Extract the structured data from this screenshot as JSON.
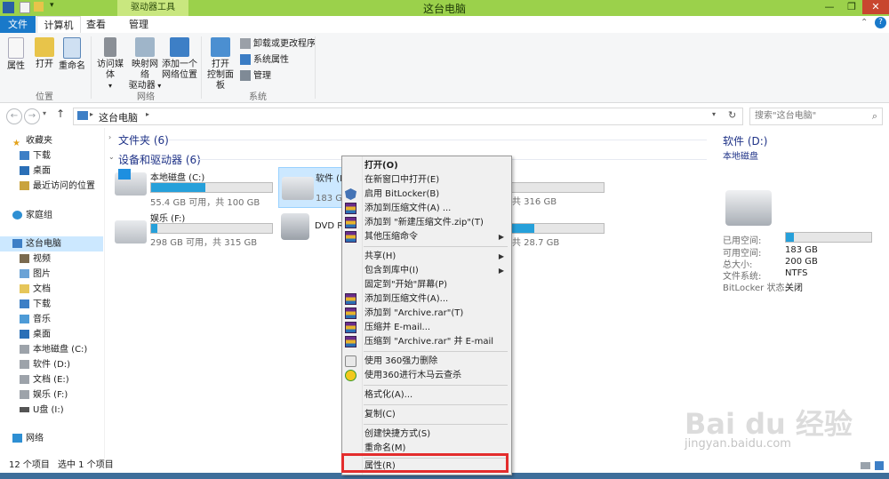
{
  "window": {
    "title": "这台电脑",
    "context_tab_header": "驱动器工具",
    "controls": [
      "—",
      "❐",
      "✕"
    ]
  },
  "tabs": {
    "file": "文件",
    "computer": "计算机",
    "view": "查看",
    "manage": "管理"
  },
  "ribbon": {
    "location": {
      "label": "位置",
      "properties": "属性",
      "open": "打开",
      "rename": "重命名"
    },
    "network": {
      "label": "网络",
      "access_media": "访问媒体",
      "map_drive_1": "映射网络",
      "map_drive_2": "驱动器",
      "add_location_1": "添加一个",
      "add_location_2": "网络位置"
    },
    "system": {
      "label": "系统",
      "open_cp_1": "打开",
      "open_cp_2": "控制面板",
      "uninstall": "卸载或更改程序",
      "system_props": "系统属性",
      "manage": "管理"
    }
  },
  "address": {
    "path": "这台电脑",
    "search_placeholder": "搜索\"这台电脑\""
  },
  "nav": {
    "favorites": "收藏夹",
    "downloads": "下载",
    "desktop": "桌面",
    "recent": "最近访问的位置",
    "homegroup": "家庭组",
    "this_pc": "这台电脑",
    "videos": "视频",
    "pictures": "图片",
    "documents": "文档",
    "downloads2": "下载",
    "music": "音乐",
    "desktop2": "桌面",
    "drive_c": "本地磁盘 (C:)",
    "drive_d": "软件 (D:)",
    "drive_e": "文档 (E:)",
    "drive_f": "娱乐 (F:)",
    "drive_i": "U盘 (I:)",
    "network": "网络"
  },
  "content": {
    "folders_header": "文件夹 (6)",
    "devices_header": "设备和驱动器 (6)",
    "drives": [
      {
        "name": "本地磁盘 (C:)",
        "free": "55.4 GB 可用，共 100 GB",
        "used_fraction": 0.45
      },
      {
        "name": "软件 (D:)",
        "free": "183 GB",
        "used_fraction": 0.09
      },
      {
        "name": "",
        "free": "共 316 GB",
        "used_fraction": 0.0
      },
      {
        "name": "娱乐 (F:)",
        "free": "298 GB 可用，共 315 GB",
        "used_fraction": 0.05
      },
      {
        "name": "DVD R",
        "free": ""
      },
      {
        "name": "",
        "free": "共 28.7 GB",
        "used_fraction": 0.25
      }
    ]
  },
  "details": {
    "title": "软件 (D:)",
    "subtitle": "本地磁盘",
    "used_label": "已用空间:",
    "used_fraction": 0.09,
    "free_label": "可用空间:",
    "free_value": "183 GB",
    "total_label": "总大小:",
    "total_value": "200 GB",
    "fs_label": "文件系统:",
    "fs_value": "NTFS",
    "bitlocker_label": "BitLocker 状态:",
    "bitlocker_value": "关闭"
  },
  "context_menu": {
    "open": "打开(O)",
    "open_new_window": "在新窗口中打开(E)",
    "bitlocker": "启用 BitLocker(B)",
    "add_archive": "添加到压缩文件(A) ...",
    "add_zip": "添加到 \"新建压缩文件.zip\"(T)",
    "other_compress": "其他压缩命令",
    "share": "共享(H)",
    "include_library": "包含到库中(I)",
    "pin_start": "固定到\"开始\"屏幕(P)",
    "add_rar_archive": "添加到压缩文件(A)...",
    "add_archive_rar": "添加到 \"Archive.rar\"(T)",
    "compress_email": "压缩并 E-mail...",
    "compress_rar_email": "压缩到 \"Archive.rar\" 并 E-mail",
    "force_delete_360": "使用 360强力删除",
    "scan_360": "使用360进行木马云查杀",
    "format": "格式化(A)...",
    "copy": "复制(C)",
    "create_shortcut": "创建快捷方式(S)",
    "rename": "重命名(M)",
    "properties": "属性(R)"
  },
  "status": {
    "items": "12 个项目",
    "selected": "选中 1 个项目"
  },
  "watermark": {
    "logo": "Bai du 经验",
    "url": "jingyan.baidu.com"
  },
  "colors": {
    "titlebar": "#9bd14b",
    "file_tab": "#1979ca",
    "bar_fill": "#26a0da",
    "highlight": "#e32d2d"
  }
}
